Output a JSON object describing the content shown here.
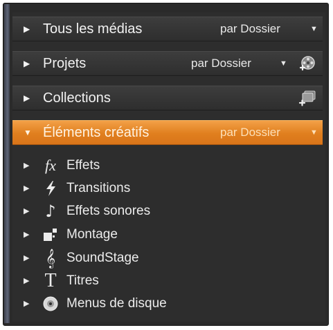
{
  "headers": [
    {
      "label": "Tous les médias",
      "sort": "par Dossier"
    },
    {
      "label": "Projets",
      "sort": "par Dossier"
    },
    {
      "label": "Collections"
    },
    {
      "label": "Éléments créatifs",
      "sort": "par Dossier"
    }
  ],
  "creative_items": [
    {
      "label": "Effets",
      "icon": "fx-icon"
    },
    {
      "label": "Transitions",
      "icon": "lightning-icon"
    },
    {
      "label": "Effets sonores",
      "icon": "music-note-icon"
    },
    {
      "label": "Montage",
      "icon": "montage-icon"
    },
    {
      "label": "SoundStage",
      "icon": "treble-clef-icon"
    },
    {
      "label": "Titres",
      "icon": "title-t-icon"
    },
    {
      "label": "Menus de disque",
      "icon": "disc-icon"
    }
  ],
  "glyphs": {
    "collapsed": "▶",
    "expanded": "▼",
    "dropdown": "▼",
    "fx": "fx",
    "music_note": "♪",
    "treble_clef": "𝄞",
    "title_t": "T"
  },
  "colors": {
    "accent": "#e58624",
    "panel": "#2d2d2d",
    "text": "#ececec"
  }
}
